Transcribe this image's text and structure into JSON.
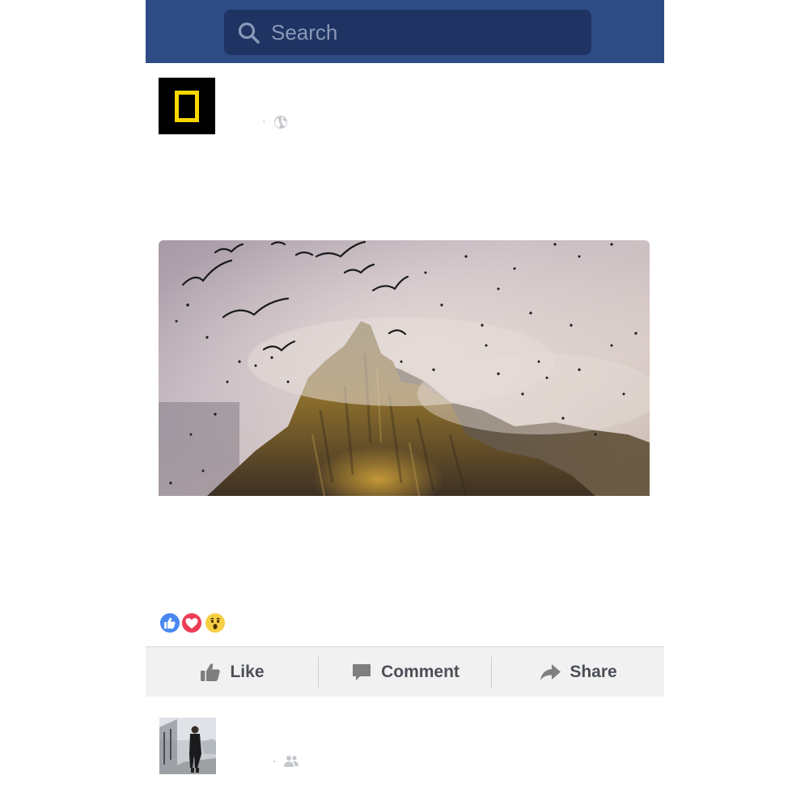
{
  "header": {
    "search_placeholder": "Search",
    "search_icon": "search-icon",
    "background_color": "#2e4b86"
  },
  "post": {
    "author": "",
    "timestamp": "",
    "separator": "·",
    "privacy_icon": "globe-icon",
    "text": "",
    "avatar_icon": "national-geographic-logo",
    "photo_alt": "seabirds flying around a misty rocky peak"
  },
  "reactions": {
    "types": [
      "like-reaction-icon",
      "love-reaction-icon",
      "wow-reaction-icon"
    ],
    "count": "",
    "colors": {
      "like": "#4a88f0",
      "love": "#ee3d55",
      "wow": "#f7cf44"
    }
  },
  "actions": {
    "like": "Like",
    "comment": "Comment",
    "share": "Share"
  },
  "next_item": {
    "author": "",
    "timestamp": "",
    "separator": "·",
    "audience_icon": "friends-icon"
  }
}
